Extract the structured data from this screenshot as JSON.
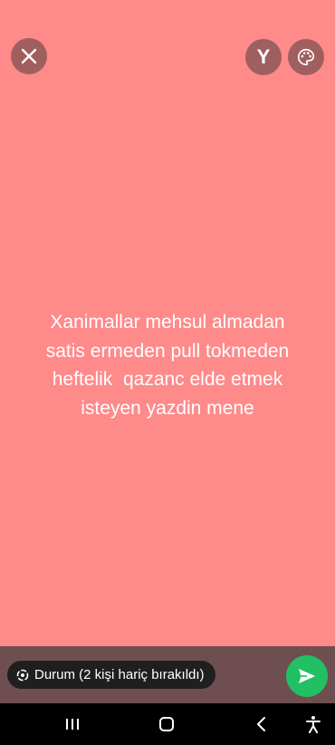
{
  "story": {
    "text": "Xanimallar mehsul almadan\nsatis ermeden pull tokmeden\nheftelik  qazanc elde etmek\nisteyen yazdin mene",
    "background_color": "#ff8a8a",
    "text_color": "#ffffff"
  },
  "toolbar": {
    "close_icon": "close-icon",
    "font_label": "Y",
    "palette_icon": "palette-icon"
  },
  "composer": {
    "audience_label": "Durum (2 kişi hariç bırakıldı)",
    "audience_icon": "status-ring-icon",
    "send_icon": "send-icon",
    "send_color": "#21c063"
  },
  "navigation": {
    "recents_icon": "recents-icon",
    "home_icon": "home-icon",
    "back_icon": "back-icon",
    "accessibility_icon": "accessibility-icon"
  }
}
